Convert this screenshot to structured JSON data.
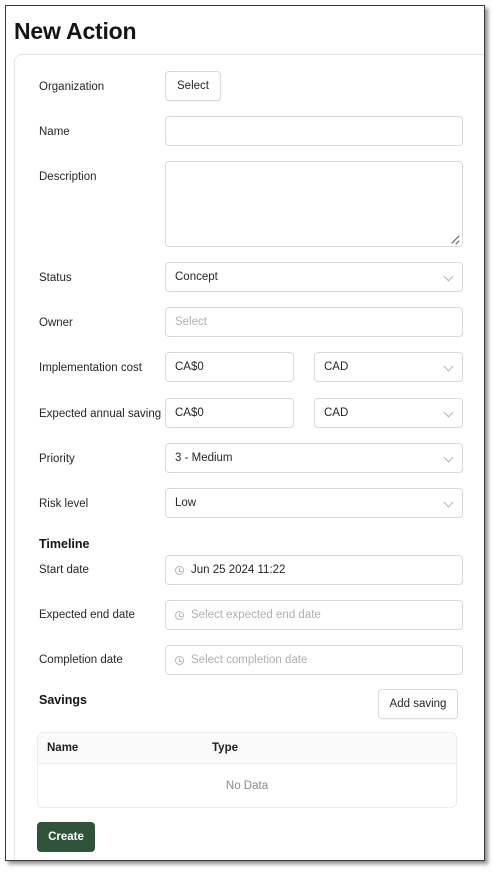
{
  "page": {
    "title": "New Action"
  },
  "form": {
    "organization": {
      "label": "Organization",
      "button_label": "Select"
    },
    "name": {
      "label": "Name",
      "value": ""
    },
    "description": {
      "label": "Description",
      "value": ""
    },
    "status": {
      "label": "Status",
      "value": "Concept"
    },
    "owner": {
      "label": "Owner",
      "placeholder": "Select"
    },
    "implementation_cost": {
      "label": "Implementation cost",
      "value": "CA$0",
      "currency": "CAD"
    },
    "expected_annual_saving": {
      "label": "Expected annual saving",
      "value": "CA$0",
      "currency": "CAD"
    },
    "priority": {
      "label": "Priority",
      "value": "3 - Medium"
    },
    "risk_level": {
      "label": "Risk level",
      "value": "Low"
    }
  },
  "timeline": {
    "title": "Timeline",
    "start_date": {
      "label": "Start date",
      "value": "Jun 25 2024 11:22"
    },
    "expected_end_date": {
      "label": "Expected end date",
      "placeholder": "Select expected end date"
    },
    "completion_date": {
      "label": "Completion date",
      "placeholder": "Select completion date"
    }
  },
  "savings": {
    "title": "Savings",
    "add_button_label": "Add saving",
    "columns": [
      "Name",
      "Type"
    ],
    "empty_text": "No Data"
  },
  "actions": {
    "create_label": "Create"
  },
  "colors": {
    "primary": "#2f5339",
    "border": "#d9d9d9",
    "placeholder": "#b0b0b0"
  },
  "icons": [
    "chevron-down-icon",
    "clock-icon",
    "resize-handle-icon"
  ]
}
